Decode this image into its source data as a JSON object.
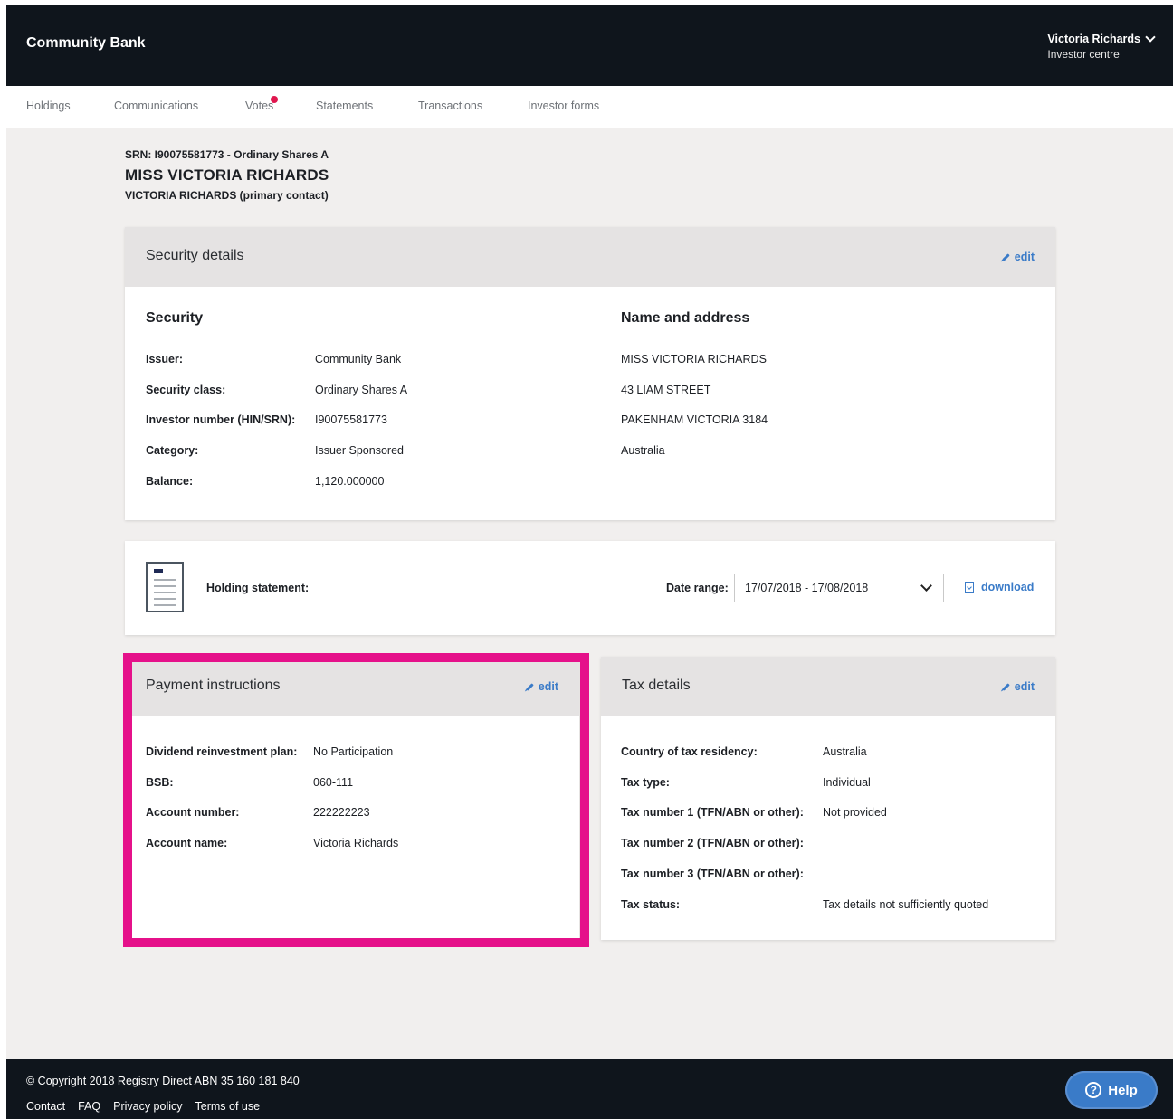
{
  "header": {
    "brand": "Community Bank",
    "user_name": "Victoria Richards",
    "user_sub": "Investor centre"
  },
  "nav": {
    "items": [
      {
        "label": "Holdings"
      },
      {
        "label": "Communications"
      },
      {
        "label": "Votes"
      },
      {
        "label": "Statements"
      },
      {
        "label": "Transactions"
      },
      {
        "label": "Investor forms"
      }
    ]
  },
  "holder": {
    "srn_line": "SRN: I90075581773 - Ordinary Shares A",
    "name": "MISS VICTORIA RICHARDS",
    "contact": "VICTORIA RICHARDS (primary contact)"
  },
  "security_details": {
    "title": "Security details",
    "edit_label": "edit",
    "security_heading": "Security",
    "rows": [
      {
        "label": "Issuer:",
        "value": "Community Bank"
      },
      {
        "label": "Security class:",
        "value": "Ordinary Shares A"
      },
      {
        "label": "Investor number (HIN/SRN):",
        "value": "I90075581773"
      },
      {
        "label": "Category:",
        "value": "Issuer Sponsored"
      },
      {
        "label": "Balance:",
        "value": "1,120.000000"
      }
    ],
    "address_heading": "Name and address",
    "address_lines": [
      "MISS VICTORIA RICHARDS",
      "43 LIAM STREET",
      "PAKENHAM VICTORIA 3184",
      "Australia"
    ]
  },
  "holding_statement": {
    "label": "Holding statement:",
    "date_range_label": "Date range:",
    "date_range_value": "17/07/2018 - 17/08/2018",
    "download_label": "download"
  },
  "payment": {
    "title": "Payment instructions",
    "edit_label": "edit",
    "rows": [
      {
        "label": "Dividend reinvestment plan:",
        "value": "No Participation"
      },
      {
        "label": "BSB:",
        "value": "060-111"
      },
      {
        "label": "Account number:",
        "value": "222222223"
      },
      {
        "label": "Account name:",
        "value": "Victoria Richards"
      }
    ]
  },
  "tax": {
    "title": "Tax details",
    "edit_label": "edit",
    "rows": [
      {
        "label": "Country of tax residency:",
        "value": "Australia"
      },
      {
        "label": "Tax type:",
        "value": "Individual"
      },
      {
        "label": "Tax number 1 (TFN/ABN or other):",
        "value": "Not provided"
      },
      {
        "label": "Tax number 2 (TFN/ABN or other):",
        "value": ""
      },
      {
        "label": "Tax number 3 (TFN/ABN or other):",
        "value": ""
      },
      {
        "label": "Tax status:",
        "value": "Tax details not sufficiently quoted"
      }
    ]
  },
  "footer": {
    "copyright": "© Copyright 2018 Registry Direct ABN 35 160 181 840",
    "links": [
      "Contact",
      "FAQ",
      "Privacy policy",
      "Terms of use"
    ],
    "help_label": "Help"
  },
  "colors": {
    "header_bg": "#0f151c",
    "accent_link": "#3a7bc8",
    "highlight": "#e5118a",
    "notification_dot": "#e0174f",
    "page_bg": "#f1efee"
  },
  "icons": [
    "chevron-down-icon",
    "pencil-icon",
    "document-icon",
    "download-icon",
    "help-icon"
  ]
}
